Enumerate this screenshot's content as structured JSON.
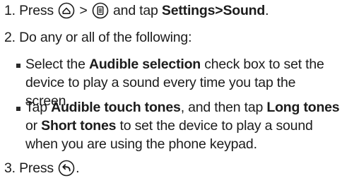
{
  "steps": {
    "s1": {
      "num": "1.",
      "press": "Press",
      "gt1": ">",
      "and_tap": "and tap",
      "settings": "Settings",
      "gt2": ">",
      "sound": "Sound",
      "period": "."
    },
    "s2": {
      "num": "2.",
      "text": "Do any or all of the following:"
    },
    "s3": {
      "num": "3.",
      "press": "Press",
      "period": "."
    }
  },
  "bullets": {
    "b1": {
      "select": "Select the",
      "audible_selection": "Audible selection",
      "rest1": "check box to set the",
      "line2": "device to play a sound every time you tap the",
      "line3": "screen."
    },
    "b2": {
      "tap": "Tap",
      "audible_touch_tones": "Audible touch tones",
      "and_then_tap": ", and then tap",
      "long_tones": "Long tones",
      "or": "or",
      "short_tones": "Short tones",
      "rest": "to set the device to play a sound",
      "line3": "when you are using the phone keypad."
    }
  },
  "icons": {
    "home": "home-key-icon",
    "menu": "menu-key-icon",
    "back": "back-key-icon"
  }
}
